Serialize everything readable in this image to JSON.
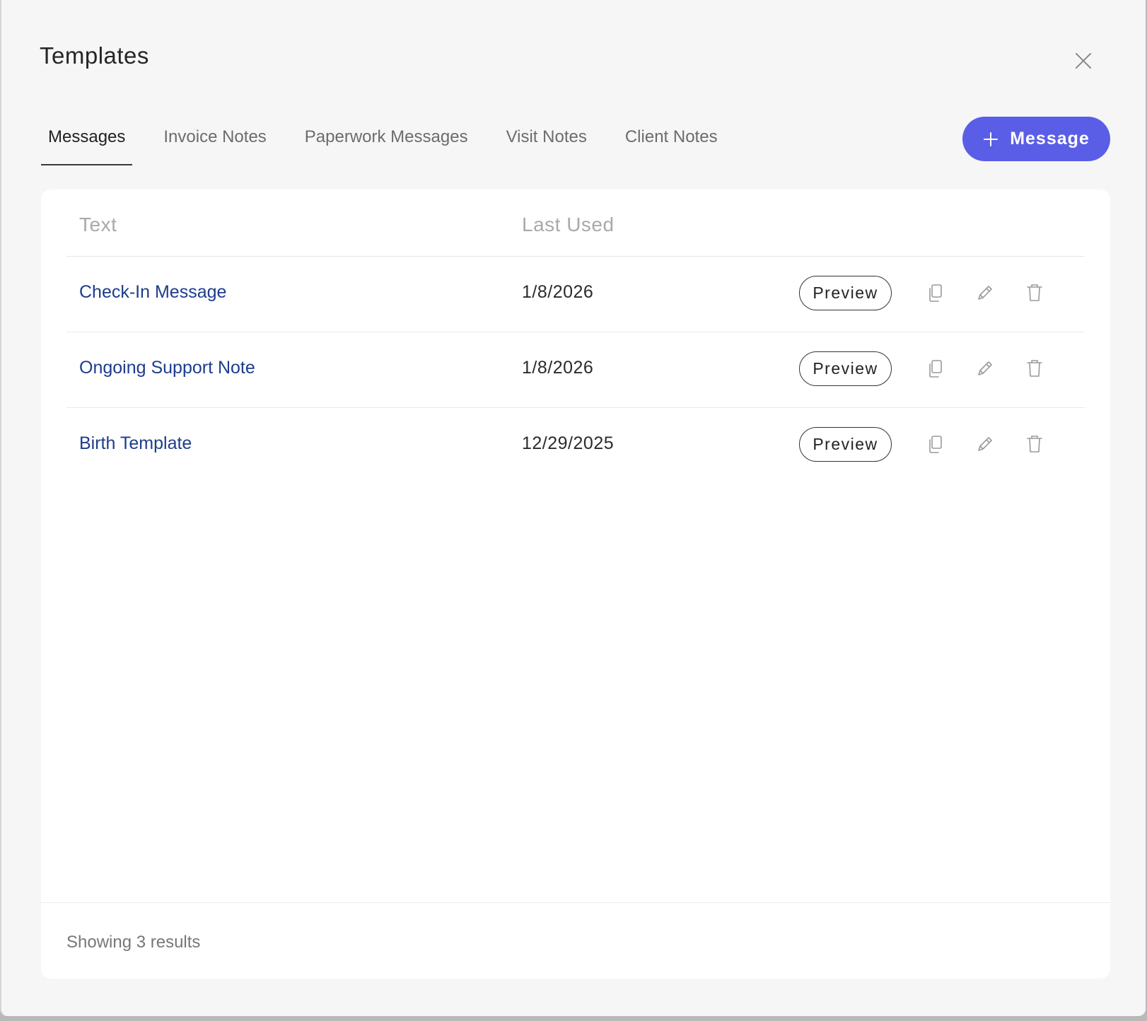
{
  "modal": {
    "title": "Templates"
  },
  "tabs": [
    {
      "label": "Messages",
      "active": true
    },
    {
      "label": "Invoice Notes",
      "active": false
    },
    {
      "label": "Paperwork Messages",
      "active": false
    },
    {
      "label": "Visit Notes",
      "active": false
    },
    {
      "label": "Client Notes",
      "active": false
    }
  ],
  "add_button": {
    "label": "Message",
    "icon": "plus-icon"
  },
  "table": {
    "columns": [
      "Text",
      "Last Used"
    ],
    "rows": [
      {
        "name": "Check-In Message",
        "last_used": "1/8/2026",
        "preview_label": "Preview"
      },
      {
        "name": "Ongoing Support Note",
        "last_used": "1/8/2026",
        "preview_label": "Preview"
      },
      {
        "name": "Birth Template",
        "last_used": "12/29/2025",
        "preview_label": "Preview"
      }
    ],
    "row_icons": [
      "copy-icon",
      "pencil-icon",
      "trash-icon"
    ]
  },
  "footer": {
    "results_text": "Showing 3 results"
  },
  "colors": {
    "accent": "#5a5ee7",
    "link": "#1d3c8e",
    "background": "#f6f6f6",
    "card": "#ffffff"
  }
}
